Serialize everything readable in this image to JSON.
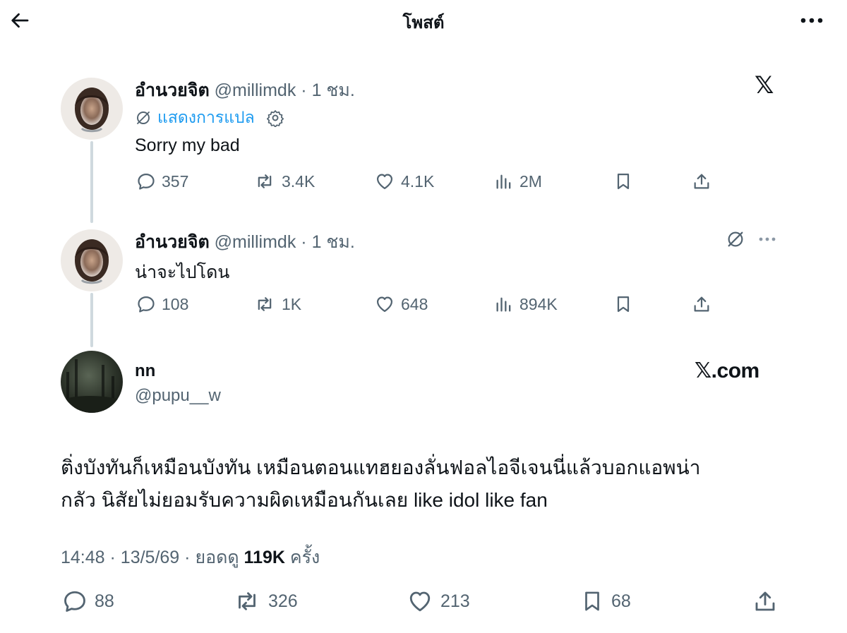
{
  "header": {
    "title": "โพสต์"
  },
  "tweet1": {
    "name": "อำนวยจิต",
    "handle": "@millimdk",
    "separator": "·",
    "time": "1 ชม.",
    "translate_label": "แสดงการแปล",
    "text": "Sorry my bad",
    "stats": {
      "replies": "357",
      "reposts": "3.4K",
      "likes": "4.1K",
      "views": "2M"
    }
  },
  "tweet2": {
    "name": "อำนวยจิต",
    "handle": "@millimdk",
    "separator": "·",
    "time": "1 ชม.",
    "text": "น่าจะไปโดน",
    "stats": {
      "replies": "108",
      "reposts": "1K",
      "likes": "648",
      "views": "894K"
    }
  },
  "quote_card": {
    "name": "nn",
    "handle": "@pupu__w",
    "brand_label": "𝕏.com"
  },
  "main_post": {
    "text_line1": "ติ่งบังทันก็เหมือนบังทัน เหมือนตอนแทฮยองลั่นฟอลไอจีเจนนี่แล้วบอกแอพน่า",
    "text_line2": "กลัว นิสัยไม่ยอมรับความผิดเหมือนกันเลย like idol like fan",
    "time": "14:48",
    "date": "13/5/69",
    "views_prefix": "ยอดดู",
    "views_count": "119K",
    "views_suffix": "ครั้ง",
    "separator": "·",
    "stats": {
      "replies": "88",
      "reposts": "326",
      "likes": "213",
      "bookmarks": "68"
    }
  },
  "icons": {
    "back": "arrow-left-icon",
    "more": "more-horizontal-icon",
    "x_logo": "x-logo-icon",
    "translate": "globe-slash-icon",
    "settings": "gear-icon",
    "reply": "reply-bubble-icon",
    "repost": "repost-icon",
    "like": "heart-icon",
    "views": "views-bars-icon",
    "bookmark": "bookmark-icon",
    "share": "share-upload-icon"
  },
  "colors": {
    "text": "#0f1419",
    "muted": "#536471",
    "link": "#1d9bf0",
    "thread_line": "#cfd9de"
  }
}
